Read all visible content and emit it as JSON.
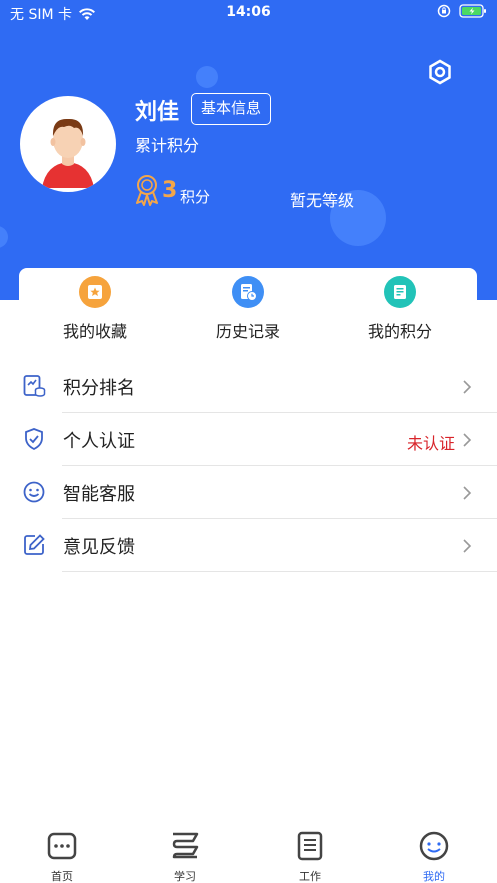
{
  "status_bar": {
    "carrier": "无 SIM 卡",
    "time": "14:06"
  },
  "profile": {
    "name": "刘佳",
    "info_button": "基本信息",
    "cumulative_label": "累计积分",
    "points_value": "3",
    "points_unit": "积分",
    "level": "暂无等级"
  },
  "quick_actions": [
    {
      "label": "我的收藏",
      "icon": "star-icon",
      "color": "#f6a33c"
    },
    {
      "label": "历史记录",
      "icon": "history-icon",
      "color": "#3f8ff5"
    },
    {
      "label": "我的积分",
      "icon": "points-icon",
      "color": "#22c3b8"
    }
  ],
  "menu": [
    {
      "label": "积分排名",
      "icon": "ranking-icon",
      "status": ""
    },
    {
      "label": "个人认证",
      "icon": "shield-icon",
      "status": "未认证"
    },
    {
      "label": "智能客服",
      "icon": "service-icon",
      "status": ""
    },
    {
      "label": "意见反馈",
      "icon": "feedback-icon",
      "status": ""
    }
  ],
  "tab_bar": {
    "tabs": [
      {
        "label": "首页",
        "icon": "home-icon"
      },
      {
        "label": "学习",
        "icon": "study-icon"
      },
      {
        "label": "工作",
        "icon": "work-icon"
      },
      {
        "label": "我的",
        "icon": "profile-icon"
      }
    ],
    "active_index": 3
  },
  "colors": {
    "primary": "#2f6bf3",
    "accent_orange": "#f3a64a",
    "warning_red": "#d8242a"
  }
}
